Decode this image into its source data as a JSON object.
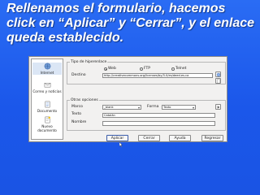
{
  "slide": {
    "headline": "Rellenamos el formulario, hacemos click en “Aplicar” y “Cerrar”, y el enlace queda establecido.",
    "background_color": "#1e5df0"
  },
  "dialog": {
    "sidebar": {
      "items": [
        {
          "label": "Internet",
          "icon": "globe-icon",
          "selected": true
        },
        {
          "label": "Correo y noticias",
          "icon": "mail-icon",
          "selected": false
        },
        {
          "label": "Documento",
          "icon": "document-icon",
          "selected": false
        },
        {
          "label": "Nuevo documento",
          "icon": "new-document-icon",
          "selected": false
        }
      ]
    },
    "hyperlink_type": {
      "title": "Tipo de hiperenlace",
      "options": [
        {
          "label": "Web",
          "selected": true
        },
        {
          "label": "FTP",
          "selected": false
        },
        {
          "label": "Telnet",
          "selected": false
        }
      ],
      "target_label": "Destino",
      "target_value": "http://creativecommons.org/licenses/by/3.0/es/deed.es.ca"
    },
    "other_options": {
      "title": "Otras opciones",
      "frame_label": "Marco",
      "frame_value": "_blank",
      "form_label": "Forma",
      "form_value": "Texto",
      "text_label": "Texto",
      "text_value": "Catalán",
      "name_label": "Nombre",
      "name_value": ""
    },
    "buttons": {
      "apply": "Aplicar",
      "close": "Cerrar",
      "help": "Ayuda",
      "back": "Regresar"
    }
  }
}
